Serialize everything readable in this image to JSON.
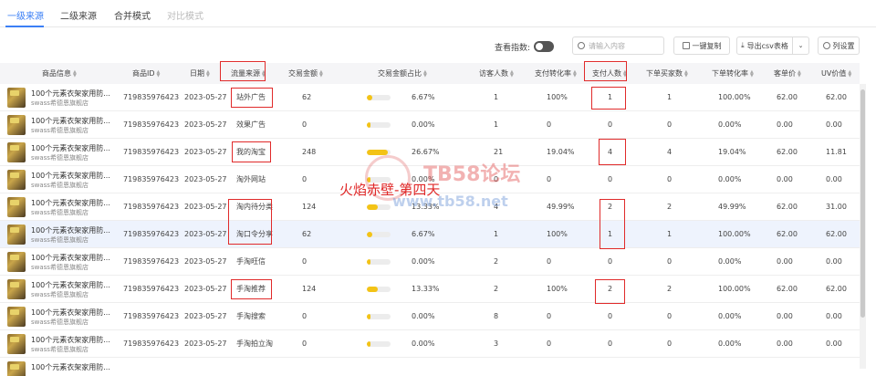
{
  "tabs": [
    "一级来源",
    "二级来源",
    "合并模式",
    "对比模式"
  ],
  "toolbar": {
    "toggle_label": "查看指数:",
    "search_placeholder": "请输入内容",
    "copy_label": "一键复制",
    "export_label": "导出csv表格",
    "columns_label": "列设置"
  },
  "columns": [
    "商品信息",
    "商品ID",
    "日期",
    "流量来源",
    "交易金额",
    "交易金额占比",
    "访客人数",
    "支付转化率",
    "支付人数",
    "下单买家数",
    "下单转化率",
    "客单价",
    "UV价值"
  ],
  "rows": [
    {
      "name": "100个元素衣架家用防...",
      "shop": "swass希德恩旗舰店",
      "id": "719835976423",
      "date": "2023-05-27",
      "source": "站外广告",
      "amount": "62",
      "share": "6.67%",
      "share_value": 0.0667,
      "visitors": "1",
      "pay_rate": "100%",
      "payers": "1",
      "order_buyers": "1",
      "order_rate": "100.00%",
      "aov": "62.00",
      "uv": "62.00"
    },
    {
      "name": "100个元素衣架家用防...",
      "shop": "swass希德恩旗舰店",
      "id": "719835976423",
      "date": "2023-05-27",
      "source": "效果广告",
      "amount": "0",
      "share": "0.00%",
      "share_value": 0,
      "visitors": "1",
      "pay_rate": "0",
      "payers": "0",
      "order_buyers": "0",
      "order_rate": "0.00%",
      "aov": "0.00",
      "uv": "0.00"
    },
    {
      "name": "100个元素衣架家用防...",
      "shop": "swass希德恩旗舰店",
      "id": "719835976423",
      "date": "2023-05-27",
      "source": "我的淘宝",
      "amount": "248",
      "share": "26.67%",
      "share_value": 0.2667,
      "visitors": "21",
      "pay_rate": "19.04%",
      "payers": "4",
      "order_buyers": "4",
      "order_rate": "19.04%",
      "aov": "62.00",
      "uv": "11.81"
    },
    {
      "name": "100个元素衣架家用防...",
      "shop": "swass希德恩旗舰店",
      "id": "719835976423",
      "date": "2023-05-27",
      "source": "淘外网站",
      "amount": "0",
      "share": "0.00%",
      "share_value": 0,
      "visitors": "0",
      "pay_rate": "0",
      "payers": "0",
      "order_buyers": "0",
      "order_rate": "0.00%",
      "aov": "0.00",
      "uv": "0.00"
    },
    {
      "name": "100个元素衣架家用防...",
      "shop": "swass希德恩旗舰店",
      "id": "719835976423",
      "date": "2023-05-27",
      "source": "淘内待分类",
      "amount": "124",
      "share": "13.33%",
      "share_value": 0.1333,
      "visitors": "4",
      "pay_rate": "49.99%",
      "payers": "2",
      "order_buyers": "2",
      "order_rate": "49.99%",
      "aov": "62.00",
      "uv": "31.00"
    },
    {
      "name": "100个元素衣架家用防...",
      "shop": "swass希德恩旗舰店",
      "id": "719835976423",
      "date": "2023-05-27",
      "source": "淘口令分享",
      "amount": "62",
      "share": "6.67%",
      "share_value": 0.0667,
      "visitors": "1",
      "pay_rate": "100%",
      "payers": "1",
      "order_buyers": "1",
      "order_rate": "100.00%",
      "aov": "62.00",
      "uv": "62.00"
    },
    {
      "name": "100个元素衣架家用防...",
      "shop": "swass希德恩旗舰店",
      "id": "719835976423",
      "date": "2023-05-27",
      "source": "手淘旺信",
      "amount": "0",
      "share": "0.00%",
      "share_value": 0,
      "visitors": "2",
      "pay_rate": "0",
      "payers": "0",
      "order_buyers": "0",
      "order_rate": "0.00%",
      "aov": "0.00",
      "uv": "0.00"
    },
    {
      "name": "100个元素衣架家用防...",
      "shop": "swass希德恩旗舰店",
      "id": "719835976423",
      "date": "2023-05-27",
      "source": "手淘推荐",
      "amount": "124",
      "share": "13.33%",
      "share_value": 0.1333,
      "visitors": "2",
      "pay_rate": "100%",
      "payers": "2",
      "order_buyers": "2",
      "order_rate": "100.00%",
      "aov": "62.00",
      "uv": "62.00"
    },
    {
      "name": "100个元素衣架家用防...",
      "shop": "swass希德恩旗舰店",
      "id": "719835976423",
      "date": "2023-05-27",
      "source": "手淘搜索",
      "amount": "0",
      "share": "0.00%",
      "share_value": 0,
      "visitors": "8",
      "pay_rate": "0",
      "payers": "0",
      "order_buyers": "0",
      "order_rate": "0.00%",
      "aov": "0.00",
      "uv": "0.00"
    },
    {
      "name": "100个元素衣架家用防...",
      "shop": "swass希德恩旗舰店",
      "id": "719835976423",
      "date": "2023-05-27",
      "source": "手淘拍立淘",
      "amount": "0",
      "share": "0.00%",
      "share_value": 0,
      "visitors": "3",
      "pay_rate": "0",
      "payers": "0",
      "order_buyers": "0",
      "order_rate": "0.00%",
      "aov": "0.00",
      "uv": "0.00"
    },
    {
      "name": "100个元素衣架家用防...",
      "shop": "",
      "id": "",
      "date": "",
      "source": "",
      "amount": "",
      "share": "",
      "share_value": 0,
      "visitors": "",
      "pay_rate": "",
      "payers": "",
      "order_buyers": "",
      "order_rate": "",
      "aov": "",
      "uv": ""
    }
  ],
  "watermark": {
    "title": "TB58论坛",
    "url": "www.tb58.net",
    "caption": "火焰赤壁-第四天"
  },
  "colors": {
    "accent": "#3b7ff5",
    "annotation": "#e02a2a",
    "bar": "#f3c316",
    "highlight_row": "#eef3fd"
  }
}
